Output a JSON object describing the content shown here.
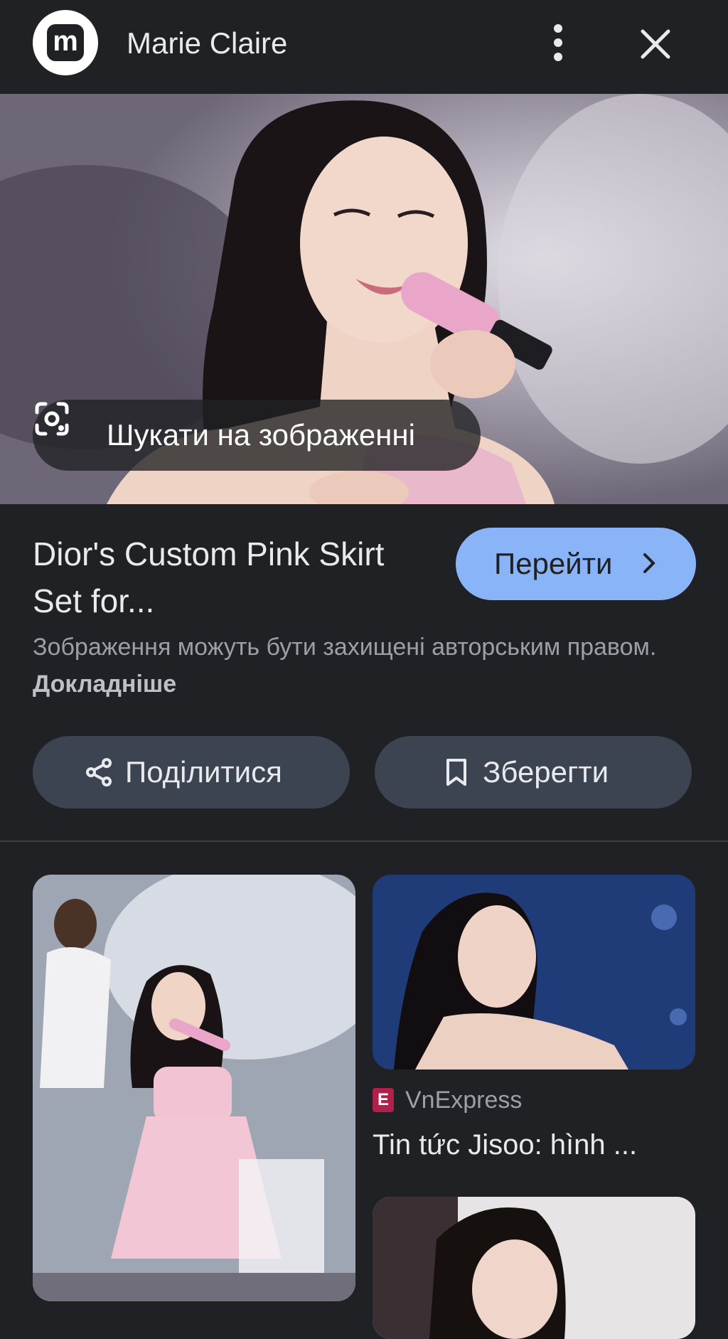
{
  "header": {
    "logo_letter": "m",
    "site_name": "Marie Claire"
  },
  "hero": {
    "lens_label": "Шукати на зображенні"
  },
  "item": {
    "title": "Dior's Custom Pink Skirt Set for...",
    "visit_label": "Перейти",
    "copyright_text": "Зображення можуть бути захищені авторським правом.",
    "learn_more": "Докладніше"
  },
  "actions": {
    "share_label": "Поділитися",
    "save_label": "Зберегти"
  },
  "related": [
    {
      "source_icon": "E",
      "source": "VnExpress",
      "title": "Tin tức Jisoo: hình ..."
    }
  ],
  "colors": {
    "background": "#202124",
    "accent_button": "#8ab4f8",
    "pill_button": "#3c4452",
    "source_icon": "#b11f4b"
  },
  "icons": [
    "more-vert-icon",
    "close-icon",
    "google-lens-icon",
    "chevron-right-icon",
    "share-icon",
    "bookmark-icon"
  ]
}
